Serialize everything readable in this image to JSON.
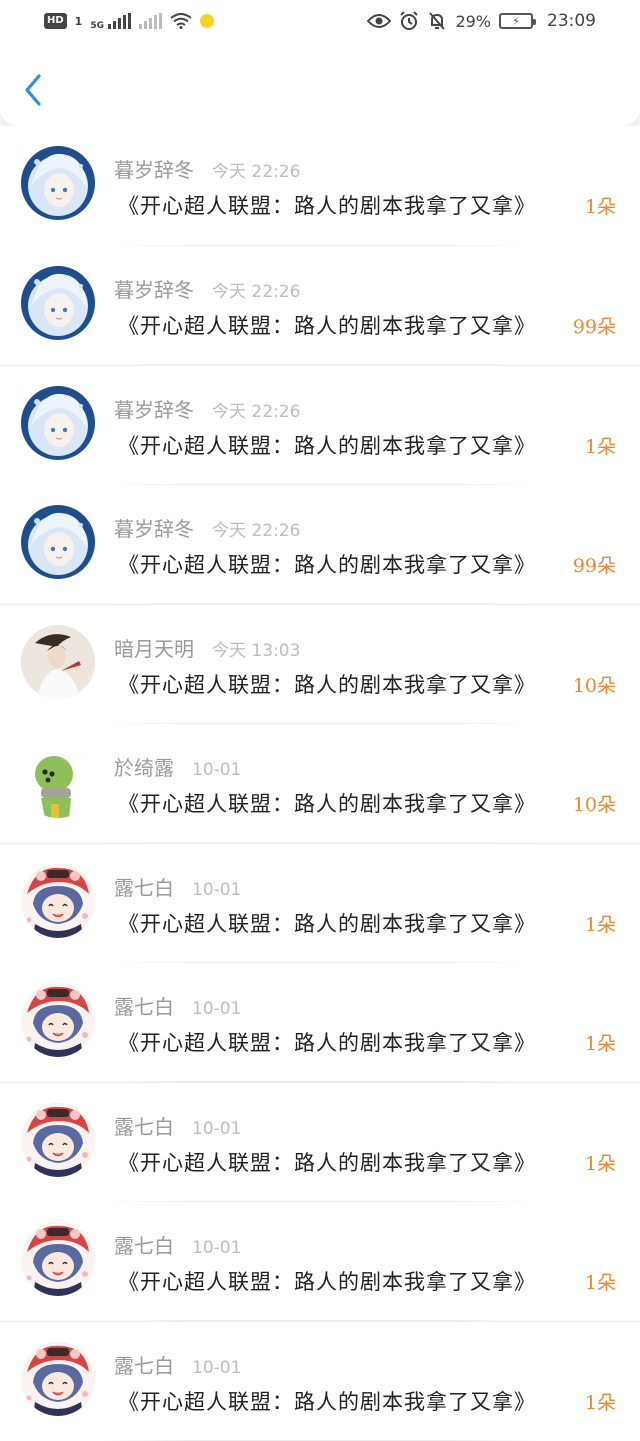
{
  "status_bar": {
    "hd_label": "HD",
    "sim_label": "1",
    "network_label": "5G",
    "battery_percent": "29%",
    "time": "23:09"
  },
  "header": {
    "back_icon": "chevron-left-icon",
    "accent_color": "#2f8fe6"
  },
  "rows": [
    {
      "username": "暮岁辞冬",
      "time": "今天 22:26",
      "message": "《开心超人联盟：路人的剧本我拿了又拿》",
      "count": "1朵",
      "avatar": "white-hair-girl"
    },
    {
      "username": "暮岁辞冬",
      "time": "今天 22:26",
      "message": "《开心超人联盟：路人的剧本我拿了又拿》",
      "count": "99朵",
      "avatar": "white-hair-girl"
    },
    {
      "username": "暮岁辞冬",
      "time": "今天 22:26",
      "message": "《开心超人联盟：路人的剧本我拿了又拿》",
      "count": "1朵",
      "avatar": "white-hair-girl"
    },
    {
      "username": "暮岁辞冬",
      "time": "今天 22:26",
      "message": "《开心超人联盟：路人的剧本我拿了又拿》",
      "count": "99朵",
      "avatar": "white-hair-girl"
    },
    {
      "username": "暗月天明",
      "time": "今天 13:03",
      "message": "《开心超人联盟：路人的剧本我拿了又拿》",
      "count": "10朵",
      "avatar": "ink-warrior"
    },
    {
      "username": "於绮露",
      "time": "10-01",
      "message": "《开心超人联盟：路人的剧本我拿了又拿》",
      "count": "10朵",
      "avatar": "green-pea"
    },
    {
      "username": "露七白",
      "time": "10-01",
      "message": "《开心超人联盟：路人的剧本我拿了又拿》",
      "count": "1朵",
      "avatar": "lion-dance-girl"
    },
    {
      "username": "露七白",
      "time": "10-01",
      "message": "《开心超人联盟：路人的剧本我拿了又拿》",
      "count": "1朵",
      "avatar": "lion-dance-girl"
    },
    {
      "username": "露七白",
      "time": "10-01",
      "message": "《开心超人联盟：路人的剧本我拿了又拿》",
      "count": "1朵",
      "avatar": "lion-dance-girl"
    },
    {
      "username": "露七白",
      "time": "10-01",
      "message": "《开心超人联盟：路人的剧本我拿了又拿》",
      "count": "1朵",
      "avatar": "lion-dance-girl"
    },
    {
      "username": "露七白",
      "time": "10-01",
      "message": "《开心超人联盟：路人的剧本我拿了又拿》",
      "count": "1朵",
      "avatar": "lion-dance-girl"
    }
  ]
}
